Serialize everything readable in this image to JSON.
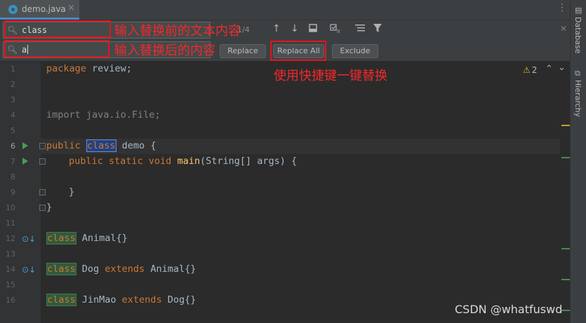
{
  "tab": {
    "filename": "demo.java",
    "close": "×"
  },
  "find": {
    "find_value": "class",
    "replace_value": "a",
    "match_count": "1/4"
  },
  "buttons": {
    "replace": "Replace",
    "replace_all": "Replace All",
    "exclude": "Exclude"
  },
  "annotations": {
    "find_note": "输入替换前的文本内容",
    "replace_note": "输入替换后的内容",
    "replace_all_note": "使用快捷键一键替换"
  },
  "icons": {
    "search": "search-icon",
    "prev": "arrow-up-icon",
    "next": "arrow-down-icon",
    "select_all": "select-all-occurrences-icon",
    "in_selection": "in-selection-icon",
    "multiline": "multiline-icon",
    "filter": "filter-icon",
    "close": "close-icon"
  },
  "inspection": {
    "warning_count": "2"
  },
  "editor": {
    "line_numbers": [
      "1",
      "2",
      "3",
      "4",
      "5",
      "6",
      "7",
      "8",
      "9",
      "10",
      "11",
      "12",
      "13",
      "14",
      "15",
      "16"
    ],
    "current_line": "6",
    "lines": {
      "l1_kw": "package",
      "l1_rest": " review;",
      "l4": "import java.io.File;",
      "l6_kw": "public ",
      "l6_match": "class",
      "l6_rest": " demo {",
      "l7_kw": "public static void ",
      "l7_fn": "main",
      "l7_rest": "(String[] args) {",
      "l9": "}",
      "l10": "}",
      "l12_match": "class",
      "l12_rest": " Animal{}",
      "l14_match": "class",
      "l14_a": " Dog ",
      "l14_kw": "extends",
      "l14_b": " Animal{}",
      "l16_match": "class",
      "l16_a": " JinMao ",
      "l16_kw": "extends",
      "l16_b": " Dog{}"
    }
  },
  "sidebar": {
    "database": "Database",
    "hierarchy": "Hierarchy"
  },
  "watermark": "CSDN @whatfuswd",
  "colors": {
    "keyword": "#cc7832",
    "function": "#ffc66d",
    "annotation_red": "#e5141c",
    "find_highlight": "#32593d"
  }
}
